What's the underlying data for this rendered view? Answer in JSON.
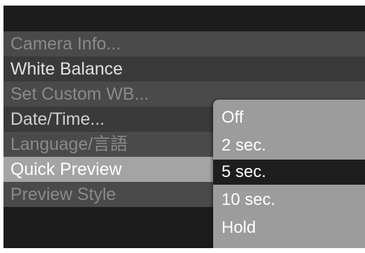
{
  "menu": {
    "items": [
      {
        "label": "Camera Info..."
      },
      {
        "label": "White Balance"
      },
      {
        "label": "Set Custom WB..."
      },
      {
        "label": "Date/Time..."
      },
      {
        "label": "Language/言語"
      },
      {
        "label": "Quick Preview"
      },
      {
        "label": "Preview Style"
      }
    ],
    "selected_label": "Quick Preview"
  },
  "submenu": {
    "options": [
      {
        "label": "Off"
      },
      {
        "label": "2 sec."
      },
      {
        "label": "5 sec."
      },
      {
        "label": "10 sec."
      },
      {
        "label": "Hold"
      }
    ],
    "selected_label": "5 sec."
  },
  "colors": {
    "lcd_background": "#1c1c1c",
    "menu_highlight": "#a4a4a4",
    "submenu_background": "#9c9c9c",
    "submenu_highlight": "#1e1e1e"
  }
}
